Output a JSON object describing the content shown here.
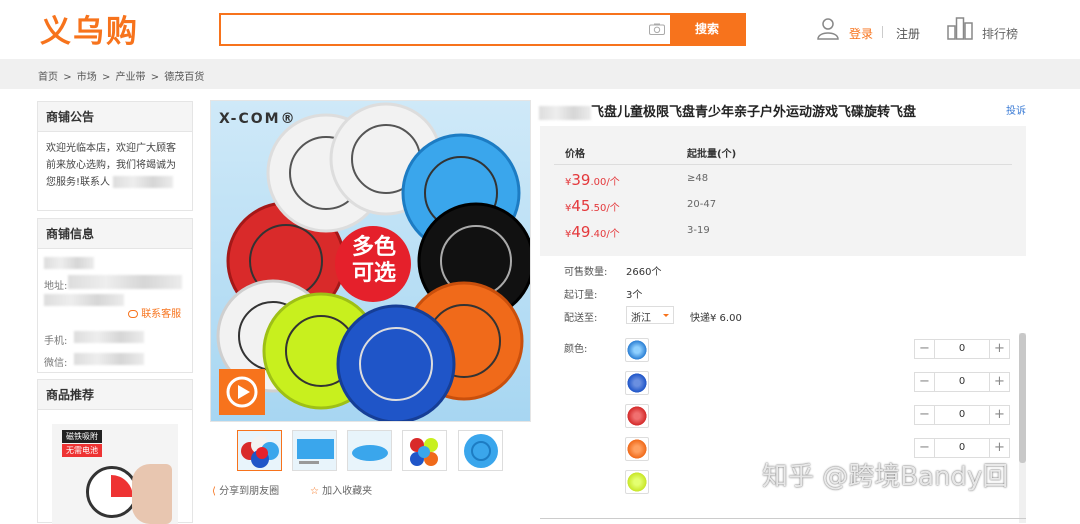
{
  "header": {
    "logo": "义乌购",
    "search_placeholder": "",
    "search_button": "搜索",
    "login": "登录",
    "register": "注册",
    "ranking": "排行榜"
  },
  "breadcrumb": [
    "首页",
    ">",
    "市场",
    ">",
    "产业带",
    ">",
    "德茂百货"
  ],
  "sidebar": {
    "notice_title": "商铺公告",
    "notice_text": "欢迎光临本店，欢迎广大顾客前来放心选购，我们将竭诚为您服务!联系人",
    "shop_title": "商铺信息",
    "address_label": "地址:",
    "service_link": "联系客服",
    "phone_label": "手机:",
    "wechat_label": "微信:",
    "recommend_title": "商品推荐",
    "recommend_tags": [
      "磁铁吸附",
      "无需电池"
    ]
  },
  "gallery": {
    "brand": "X-COM®",
    "badge": "多色\n可选",
    "share": "分享到朋友圈",
    "favorite": "加入收藏夹"
  },
  "product": {
    "title": "飞盘儿童极限飞盘青少年亲子户外运动游戏飞碟旋转飞盘",
    "report": "投诉",
    "price_header": "价格",
    "moq_header": "起批量(个)",
    "tiers": [
      {
        "currency": "¥",
        "int": "39",
        "dec": ".00/个",
        "moq": "≥48"
      },
      {
        "currency": "¥",
        "int": "45",
        "dec": ".50/个",
        "moq": "20-47"
      },
      {
        "currency": "¥",
        "int": "49",
        "dec": ".40/个",
        "moq": "3-19"
      }
    ],
    "stock_label": "可售数量:",
    "stock_value": "2660个",
    "min_order_label": "起订量:",
    "min_order_value": "3个",
    "ship_label": "配送至:",
    "ship_region": "浙江",
    "ship_fee": "快递¥ 6.00",
    "color_label": "颜色:",
    "color_rows": [
      {
        "color": "#2b7fd4",
        "qty": "0"
      },
      {
        "color": "#1f55c8",
        "qty": "0"
      },
      {
        "color": "#d42a2a",
        "qty": "0"
      },
      {
        "color": "#f06a1a",
        "qty": "0"
      },
      {
        "color": "#c8e628",
        "qty": "0"
      }
    ]
  },
  "watermark": "知乎 @跨境Bandy回",
  "colors": {
    "accent": "#f7731c",
    "price": "#e4393c",
    "link": "#3a7bd5"
  }
}
